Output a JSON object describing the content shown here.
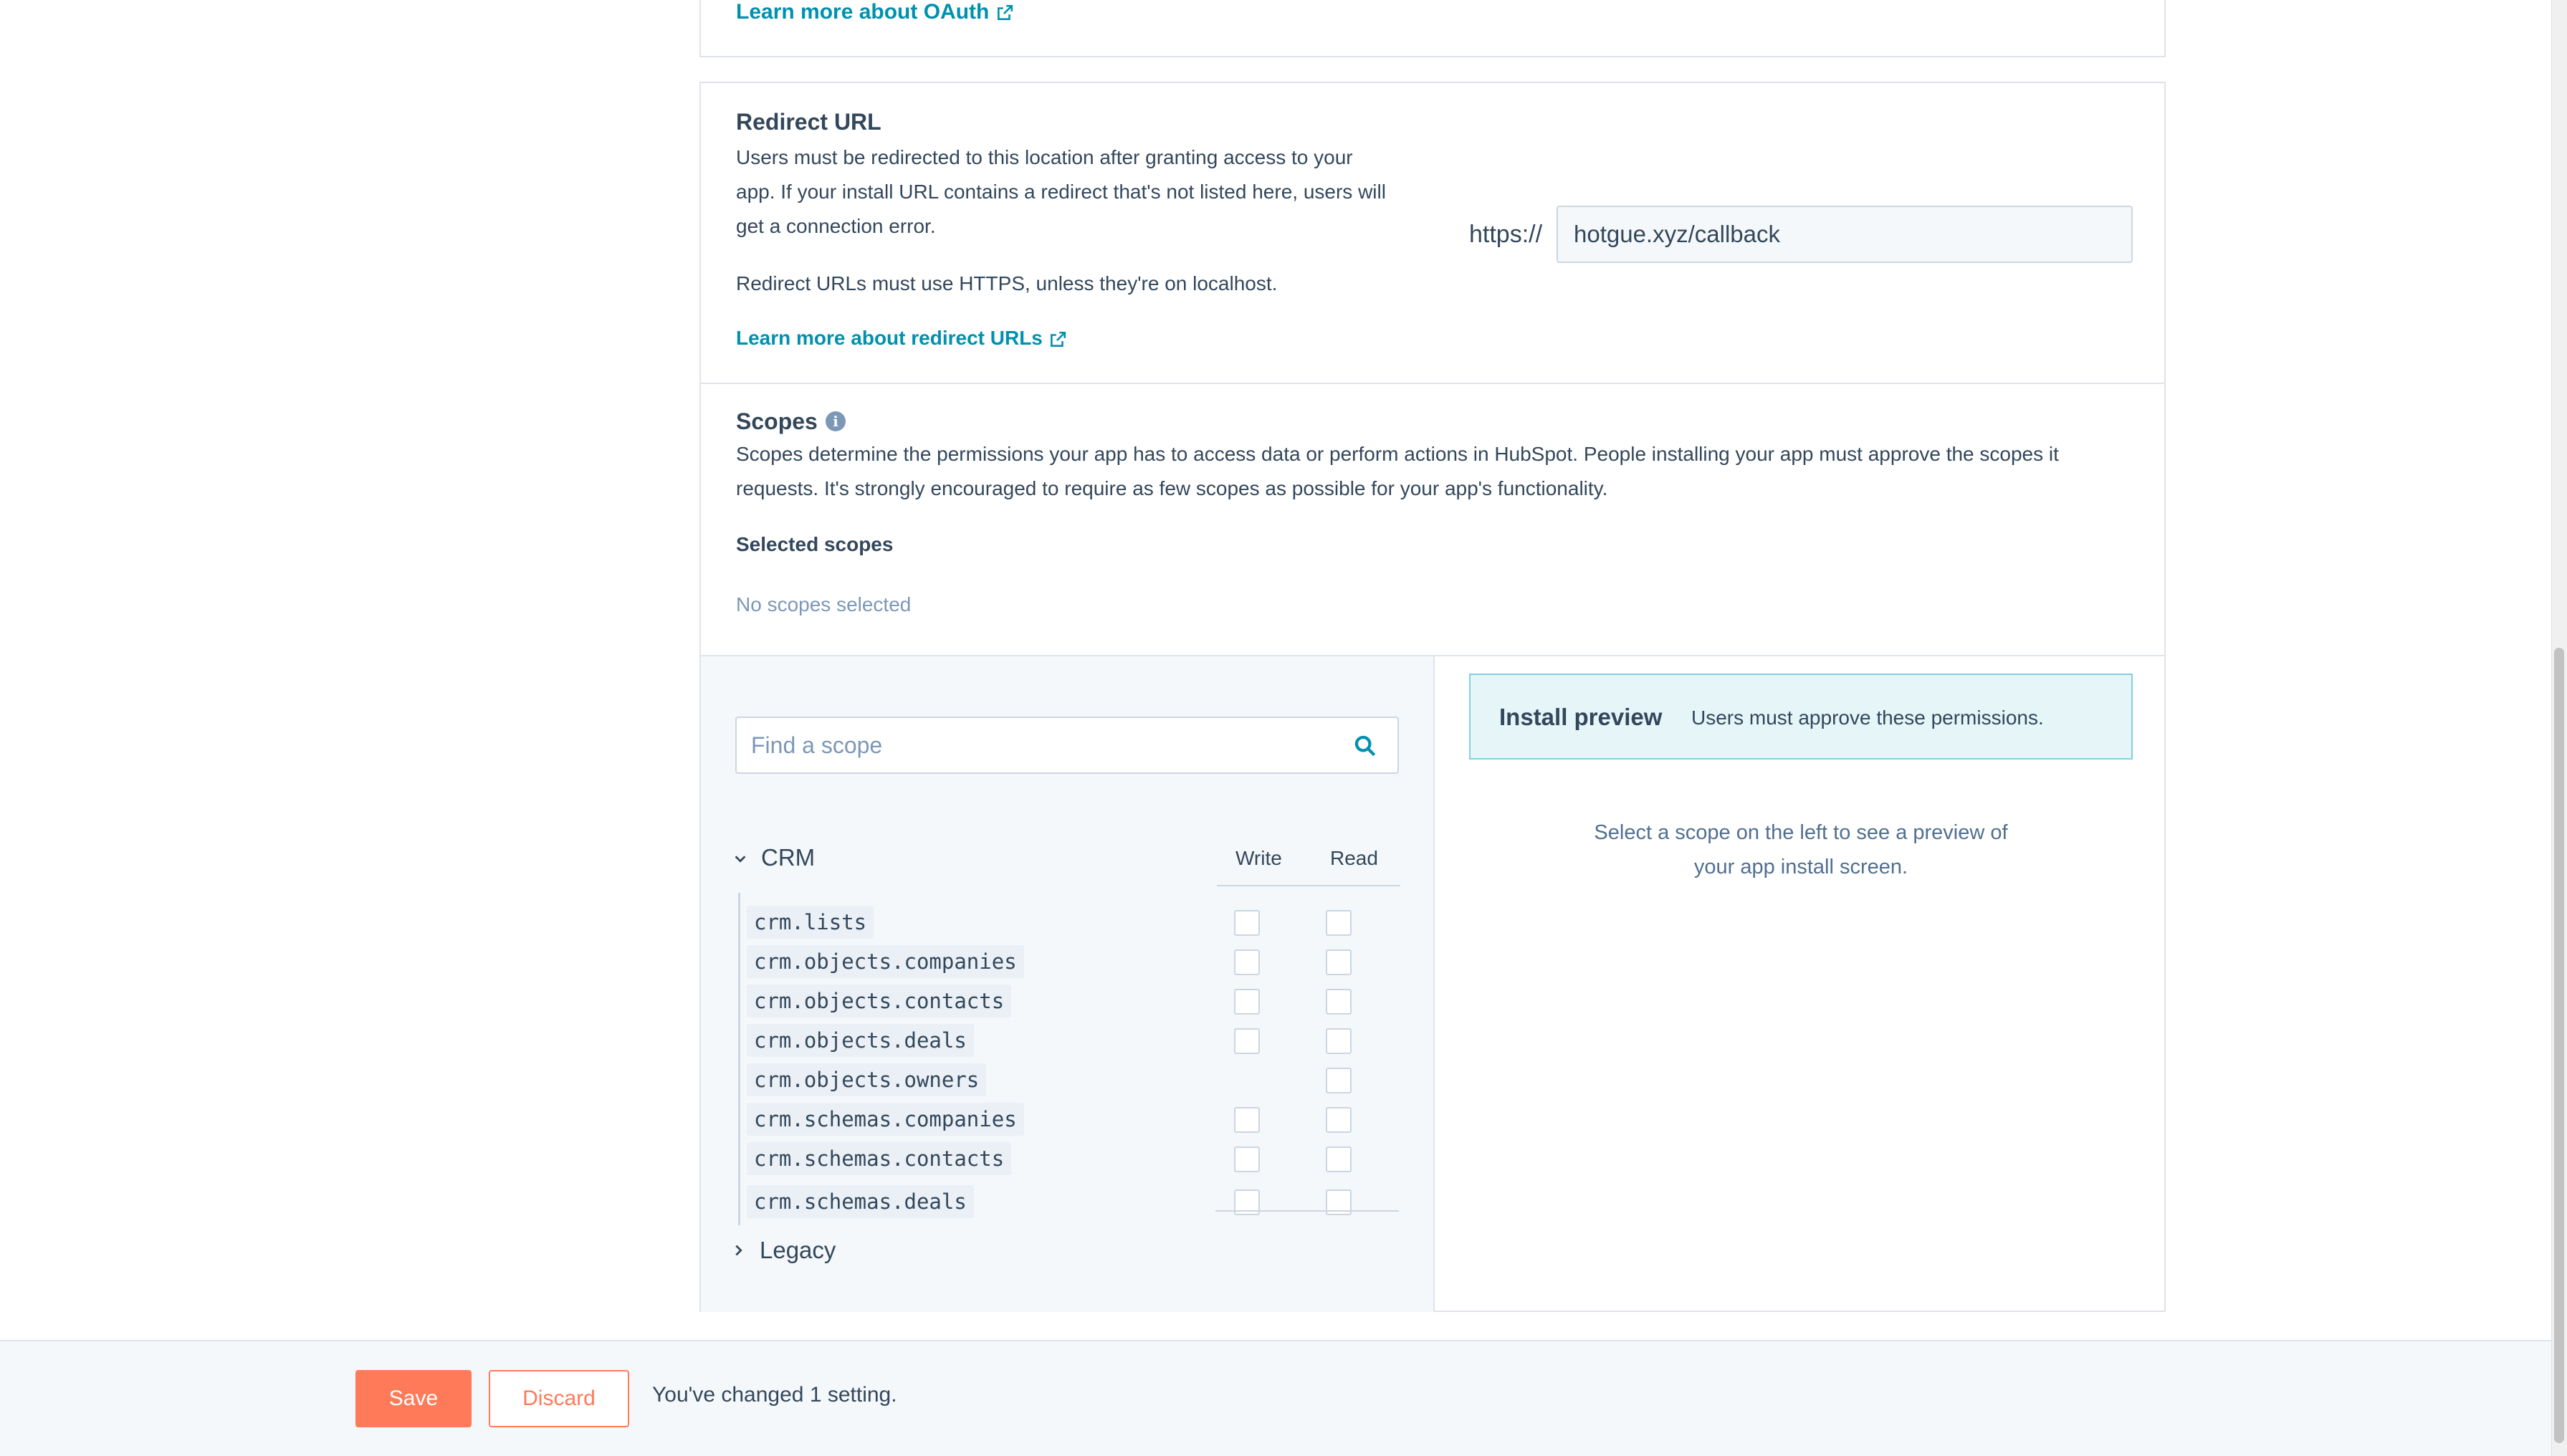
{
  "oauth": {
    "learn_more_link": "Learn more about OAuth"
  },
  "redirect": {
    "title": "Redirect URL",
    "description_lines": [
      "Users must be redirected to this location after granting access to your",
      "app. If your install URL contains a redirect that's not listed here, users will",
      "get a connection error."
    ],
    "https_note": "Redirect URLs must use HTTPS, unless they're on localhost.",
    "learn_more_link": "Learn more about redirect URLs",
    "prefix": "https://",
    "url_value": "hotgue.xyz/callback"
  },
  "scopes": {
    "title": "Scopes",
    "description_lines": [
      "Scopes determine the permissions your app has to access data or perform actions in HubSpot. People installing your app must approve the scopes it",
      "requests. It's strongly encouraged to require as few scopes as possible for your app's functionality."
    ],
    "selected_label": "Selected scopes",
    "none_selected": "No scopes selected",
    "search_placeholder": "Find a scope",
    "group_crm": "CRM",
    "col_write": "Write",
    "col_read": "Read",
    "items": [
      {
        "name": "crm.lists",
        "write": true,
        "read": true
      },
      {
        "name": "crm.objects.companies",
        "write": true,
        "read": true
      },
      {
        "name": "crm.objects.contacts",
        "write": true,
        "read": true
      },
      {
        "name": "crm.objects.deals",
        "write": true,
        "read": true
      },
      {
        "name": "crm.objects.owners",
        "write": false,
        "read": true
      },
      {
        "name": "crm.schemas.companies",
        "write": true,
        "read": true
      },
      {
        "name": "crm.schemas.contacts",
        "write": true,
        "read": true
      },
      {
        "name": "crm.schemas.deals",
        "write": true,
        "read": true
      }
    ],
    "group_legacy": "Legacy"
  },
  "preview": {
    "title": "Install preview",
    "subtitle": "Users must approve these permissions.",
    "hint_lines": [
      "Select a scope on the left to see a preview of",
      "your app install screen."
    ]
  },
  "footer": {
    "save_label": "Save",
    "discard_label": "Discard",
    "changed_message": "You've changed 1 setting."
  },
  "colors": {
    "accent": "#ff7a59",
    "link": "#0091ae",
    "text": "#33475b"
  }
}
